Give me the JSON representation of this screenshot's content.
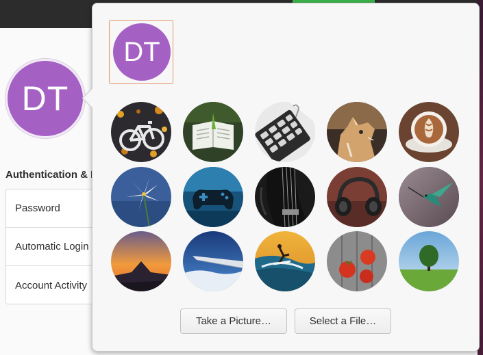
{
  "user": {
    "initials": "DT",
    "avatar_color": "#a560c4"
  },
  "settings": {
    "auth_heading": "Authentication & Login",
    "auth_rows": [
      {
        "label": "Password"
      },
      {
        "label": "Automatic Login"
      },
      {
        "label": "Account Activity"
      }
    ]
  },
  "popover": {
    "current_initials": "DT",
    "selected_border_color": "#e4936b",
    "pictures": [
      {
        "name": "bicycle"
      },
      {
        "name": "book"
      },
      {
        "name": "calculator"
      },
      {
        "name": "cat"
      },
      {
        "name": "coffee"
      },
      {
        "name": "flower"
      },
      {
        "name": "gamepad"
      },
      {
        "name": "guitar"
      },
      {
        "name": "headphones"
      },
      {
        "name": "hummingbird"
      },
      {
        "name": "mountain"
      },
      {
        "name": "plane"
      },
      {
        "name": "surfer"
      },
      {
        "name": "tomatoes"
      },
      {
        "name": "tree"
      }
    ],
    "take_picture_label": "Take a Picture…",
    "select_file_label": "Select a File…"
  }
}
